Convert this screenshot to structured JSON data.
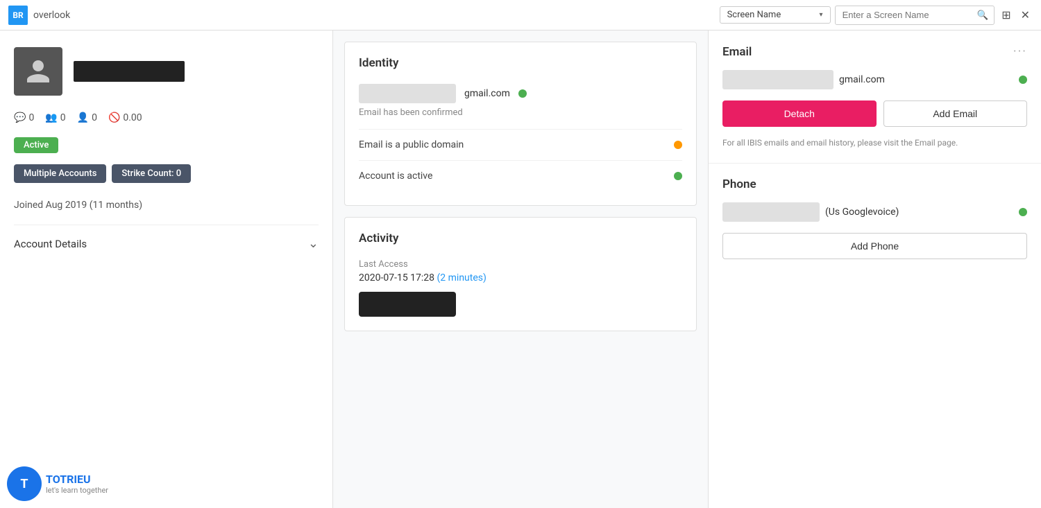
{
  "topbar": {
    "initials": "BR",
    "site_name": "overlook",
    "screen_name_label": "Screen Name",
    "search_placeholder": "Enter a Screen Name"
  },
  "left_panel": {
    "status_badge": "Active",
    "tags": [
      {
        "label": "Multiple Accounts"
      },
      {
        "label": "Strike Count: 0"
      }
    ],
    "join_info": "Joined Aug 2019 (11 months)",
    "account_details_label": "Account Details",
    "stats": [
      {
        "icon": "chat-icon",
        "value": "0"
      },
      {
        "icon": "groups-icon",
        "value": "0"
      },
      {
        "icon": "user-plus-icon",
        "value": "0"
      },
      {
        "icon": "ban-icon",
        "value": "0.00"
      }
    ]
  },
  "identity_section": {
    "title": "Identity",
    "email_suffix": "gmail.com",
    "confirmed_text": "Email has been confirmed",
    "checks": [
      {
        "label": "Email is a public domain",
        "dot_color": "orange"
      },
      {
        "label": "Account is active",
        "dot_color": "green"
      }
    ]
  },
  "activity_section": {
    "title": "Activity",
    "last_access_label": "Last Access",
    "last_access_time": "2020-07-15  17:28",
    "last_access_ago": "(2 minutes)"
  },
  "email_section": {
    "title": "Email",
    "email_suffix": "gmail.com",
    "detach_label": "Detach",
    "add_email_label": "Add Email",
    "ibis_note": "For all IBIS emails and email history, please visit the Email page."
  },
  "phone_section": {
    "title": "Phone",
    "phone_label": "(Us Googlevoice)",
    "add_phone_label": "Add Phone"
  },
  "watermark": {
    "logo_letter": "T",
    "name": "TOTRIEU",
    "tagline": "let's learn together"
  }
}
